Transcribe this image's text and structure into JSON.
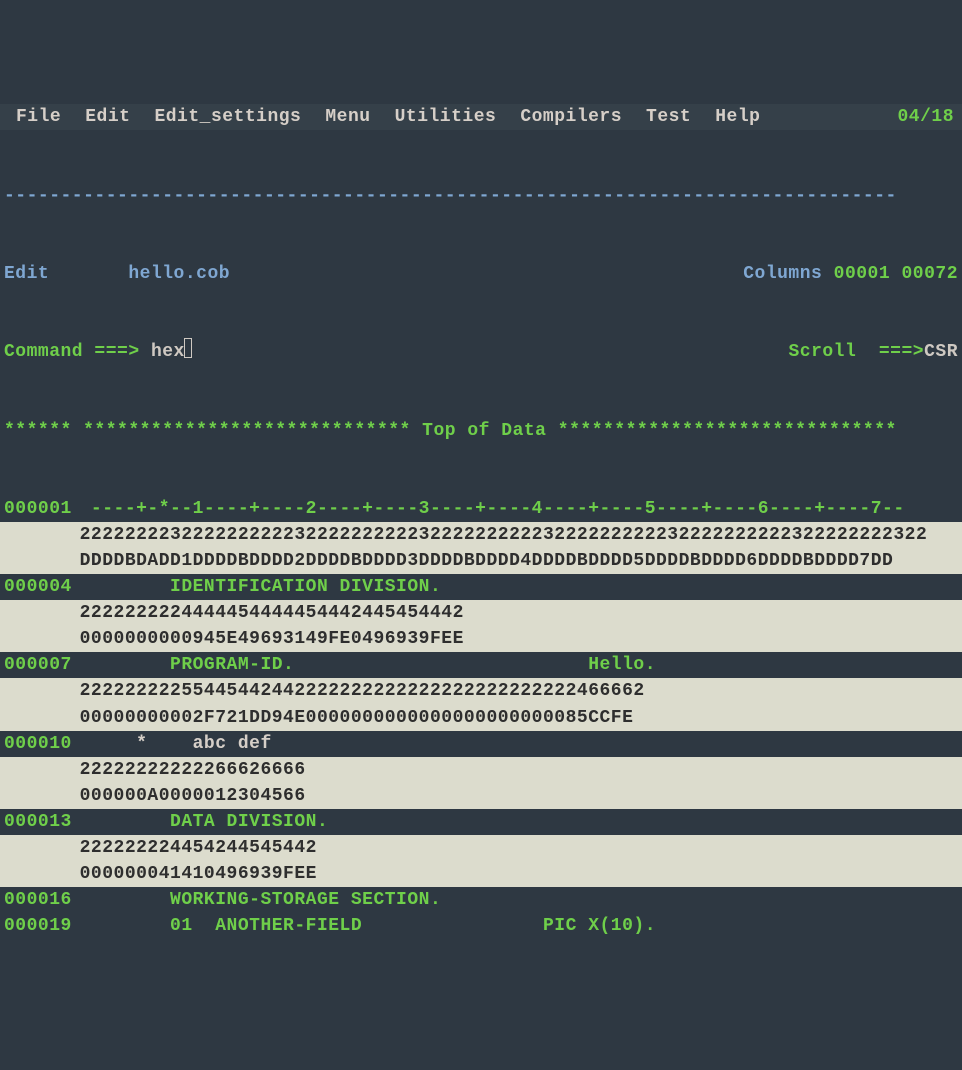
{
  "menubar": {
    "items": [
      "File",
      "Edit",
      "Edit_settings",
      "Menu",
      "Utilities",
      "Compilers",
      "Test",
      "Help"
    ],
    "date": "04/18"
  },
  "dashes": "-------------------------------------------------------------------------------",
  "header": {
    "mode": "Edit",
    "filename": "hello.cob",
    "columns_lbl": "Columns",
    "col_from": "00001",
    "col_to": "00072"
  },
  "cmd": {
    "label": "Command ===>",
    "value": "hex",
    "scroll_lbl": "Scroll  ===>",
    "scroll_val": "CSR"
  },
  "topline": "****** ***************************** Top of Data ******************************",
  "lines": [
    {
      "num": "000001",
      "text": "----+-*--1----+----2----+----3----+----4----+----5----+----6----+----7--",
      "hex1": "222222223222222222232222222222322222222223222222222232222222222322222222322",
      "hex2": "DDDDBDADD1DDDDBDDDD2DDDDBDDDD3DDDDBDDDD4DDDDBDDDD5DDDDBDDDD6DDDDBDDDD7DD"
    },
    {
      "num": "000004",
      "text": "       IDENTIFICATION DIVISION.",
      "hex1": "2222222224444454444454442445454442",
      "hex2": "0000000000945E49693149FE0496939FEE"
    },
    {
      "num": "000007",
      "text": "       PROGRAM-ID.                          Hello.",
      "hex1": "22222222255445442442222222222222222222222222466662",
      "hex2": "00000000002F721DD94E0000000000000000000000085CCFE"
    },
    {
      "num": "000010",
      "text": "    *    abc def",
      "hex1": "22222222222266626666",
      "hex2": "000000A0000012304566",
      "light": true
    },
    {
      "num": "000013",
      "text": "       DATA DIVISION.",
      "hex1": "222222224454244545442",
      "hex2": "000000041410496939FEE"
    },
    {
      "num": "000016",
      "text": "       WORKING-STORAGE SECTION."
    },
    {
      "num": "000019",
      "text": "       01  ANOTHER-FIELD                PIC X(10)."
    }
  ]
}
